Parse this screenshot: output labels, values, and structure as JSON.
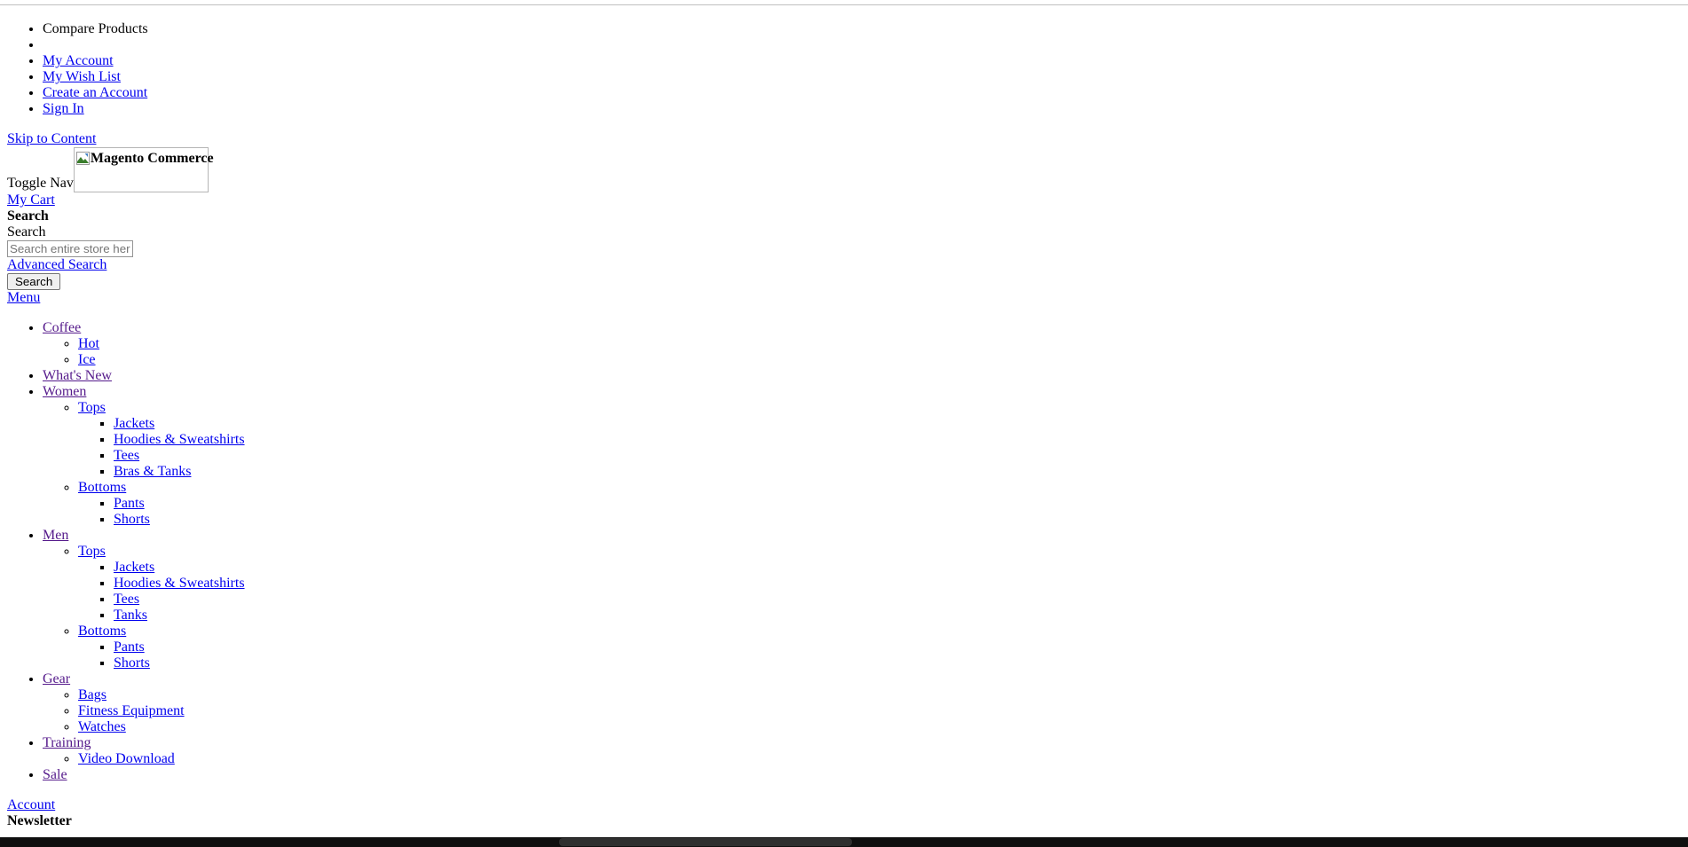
{
  "panel": {
    "items": [
      {
        "label": "Compare Products",
        "type": "text"
      },
      {
        "label": "",
        "type": "text"
      },
      {
        "label": "My Account",
        "type": "link"
      },
      {
        "label": "My Wish List",
        "type": "link"
      },
      {
        "label": "Create an Account",
        "type": "link"
      },
      {
        "label": "Sign In",
        "type": "link"
      }
    ]
  },
  "skip": {
    "label": "Skip to Content"
  },
  "header": {
    "logo_alt": "Magento Commerce",
    "toggle_nav": "Toggle Nav",
    "cart_label": "My Cart"
  },
  "search": {
    "heading": "Search",
    "field_label": "Search",
    "value": "",
    "placeholder": "Search entire store here...",
    "advanced_label": "Advanced Search",
    "button_label": "Search"
  },
  "nav": {
    "menu_label": "Menu",
    "items": [
      {
        "label": "Coffee",
        "visited": true,
        "children": [
          {
            "label": "Hot",
            "visited": false,
            "children": []
          },
          {
            "label": "Ice",
            "visited": false,
            "children": []
          }
        ]
      },
      {
        "label": "What's New",
        "visited": true,
        "children": []
      },
      {
        "label": "Women",
        "visited": true,
        "children": [
          {
            "label": "Tops",
            "visited": false,
            "children": [
              {
                "label": "Jackets",
                "visited": false
              },
              {
                "label": "Hoodies & Sweatshirts",
                "visited": false
              },
              {
                "label": "Tees",
                "visited": false
              },
              {
                "label": "Bras & Tanks",
                "visited": false
              }
            ]
          },
          {
            "label": "Bottoms",
            "visited": false,
            "children": [
              {
                "label": "Pants",
                "visited": false
              },
              {
                "label": "Shorts",
                "visited": false
              }
            ]
          }
        ]
      },
      {
        "label": "Men",
        "visited": true,
        "children": [
          {
            "label": "Tops",
            "visited": false,
            "children": [
              {
                "label": "Jackets",
                "visited": false
              },
              {
                "label": "Hoodies & Sweatshirts",
                "visited": false
              },
              {
                "label": "Tees",
                "visited": false
              },
              {
                "label": "Tanks",
                "visited": false
              }
            ]
          },
          {
            "label": "Bottoms",
            "visited": false,
            "children": [
              {
                "label": "Pants",
                "visited": false
              },
              {
                "label": "Shorts",
                "visited": false
              }
            ]
          }
        ]
      },
      {
        "label": "Gear",
        "visited": true,
        "children": [
          {
            "label": "Bags",
            "visited": false,
            "children": []
          },
          {
            "label": "Fitness Equipment",
            "visited": false,
            "children": []
          },
          {
            "label": "Watches",
            "visited": false,
            "children": []
          }
        ]
      },
      {
        "label": "Training",
        "visited": true,
        "children": [
          {
            "label": "Video Download",
            "visited": false,
            "children": []
          }
        ]
      },
      {
        "label": "Sale",
        "visited": true,
        "children": []
      }
    ]
  },
  "footer": {
    "account_label": "Account",
    "newsletter_heading": "Newsletter"
  },
  "colors": {
    "link": "#0000ee",
    "visited_link": "#551a8b",
    "text": "#000000",
    "background": "#ffffff",
    "scrollbar_track": "#0f0f0f",
    "scrollbar_thumb": "#2f2f2f"
  }
}
